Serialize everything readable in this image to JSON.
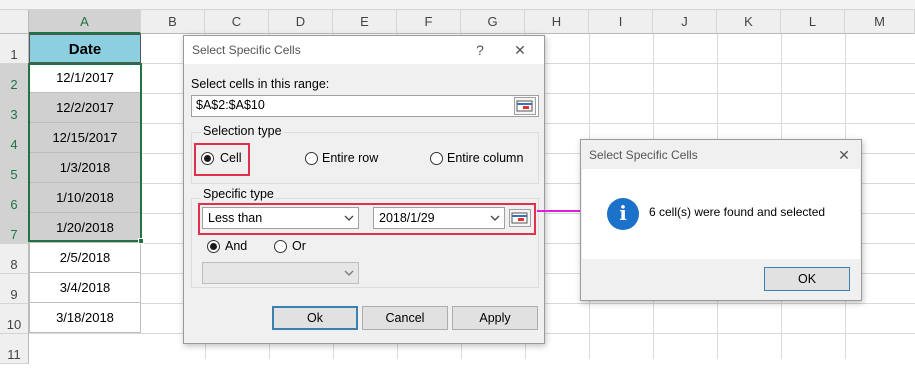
{
  "spreadsheet": {
    "columns": [
      "A",
      "B",
      "C",
      "D",
      "E",
      "F",
      "G",
      "H",
      "I",
      "J",
      "K",
      "L",
      "M"
    ],
    "rows": [
      "1",
      "2",
      "3",
      "4",
      "5",
      "6",
      "7",
      "8",
      "9",
      "10",
      "11"
    ],
    "header_cell": "Date",
    "dates": [
      "12/1/2017",
      "12/2/2017",
      "12/15/2017",
      "1/3/2018",
      "1/10/2018",
      "1/20/2018",
      "2/5/2018",
      "3/4/2018",
      "3/18/2018"
    ]
  },
  "dialog_main": {
    "title": "Select Specific Cells",
    "help_glyph": "?",
    "close_glyph": "✕",
    "range_label": "Select cells in this range:",
    "range_value": "$A$2:$A$10",
    "selection_type_label": "Selection type",
    "selection_options": [
      "Cell",
      "Entire row",
      "Entire column"
    ],
    "selected_option": "Cell",
    "specific_type_label": "Specific type",
    "condition1_operator": "Less than",
    "condition1_value": "2018/1/29",
    "logic_and": "And",
    "logic_or": "Or",
    "logic_selected": "And",
    "condition2_operator": "",
    "ok_label": "Ok",
    "cancel_label": "Cancel",
    "apply_label": "Apply"
  },
  "dialog_result": {
    "title": "Select Specific Cells",
    "close_glyph": "✕",
    "message": "6 cell(s) were found and selected",
    "info_glyph": "i",
    "ok_label": "OK"
  },
  "colors": {
    "header_fill": "#8ccfe0",
    "selected_fill": "#d0d0d0",
    "selection_green": "#217346",
    "highlight_red": "#e0304a",
    "arrow_magenta": "#e020d8",
    "info_blue": "#1c72c8"
  },
  "icons": [
    "range-picker-icon",
    "dropdown-chevron-icon",
    "info-icon",
    "arrow-icon",
    "close-icon",
    "help-icon"
  ]
}
